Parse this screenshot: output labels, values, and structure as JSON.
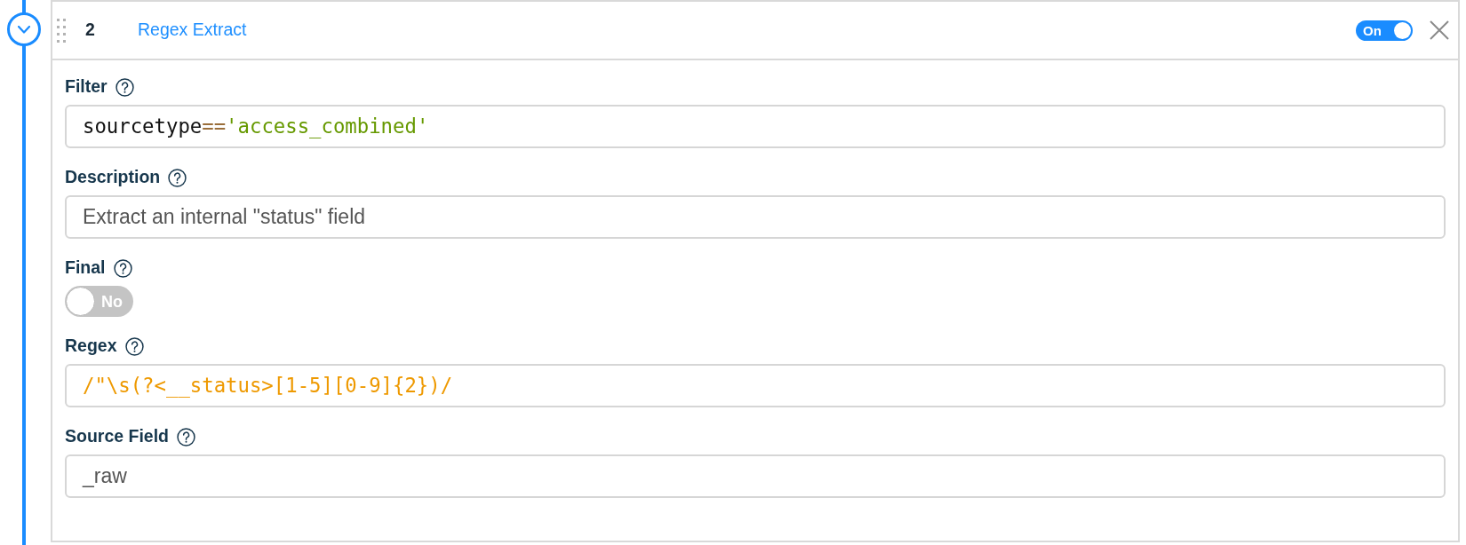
{
  "timeline": {
    "expanded": true
  },
  "function": {
    "number": "2",
    "title": "Regex Extract",
    "enabled": {
      "on": true,
      "label": "On"
    }
  },
  "fields": [
    {
      "kind": "code",
      "label": "Filter",
      "tokens": [
        {
          "text": "sourcetype",
          "kind": "identifier"
        },
        {
          "text": "==",
          "kind": "operator"
        },
        {
          "text": "'access_combined'",
          "kind": "string"
        }
      ]
    },
    {
      "kind": "text",
      "label": "Description",
      "value": "Extract an internal \"status\" field"
    },
    {
      "kind": "toggle",
      "label": "Final",
      "on": false,
      "state_label": "No"
    },
    {
      "kind": "code",
      "label": "Regex",
      "tokens": [
        {
          "text": "/\"\\s(?<__status>[1-5][0-9]{2})/",
          "kind": "regex"
        }
      ]
    },
    {
      "kind": "text",
      "label": "Source Field",
      "value": "_raw"
    }
  ]
}
